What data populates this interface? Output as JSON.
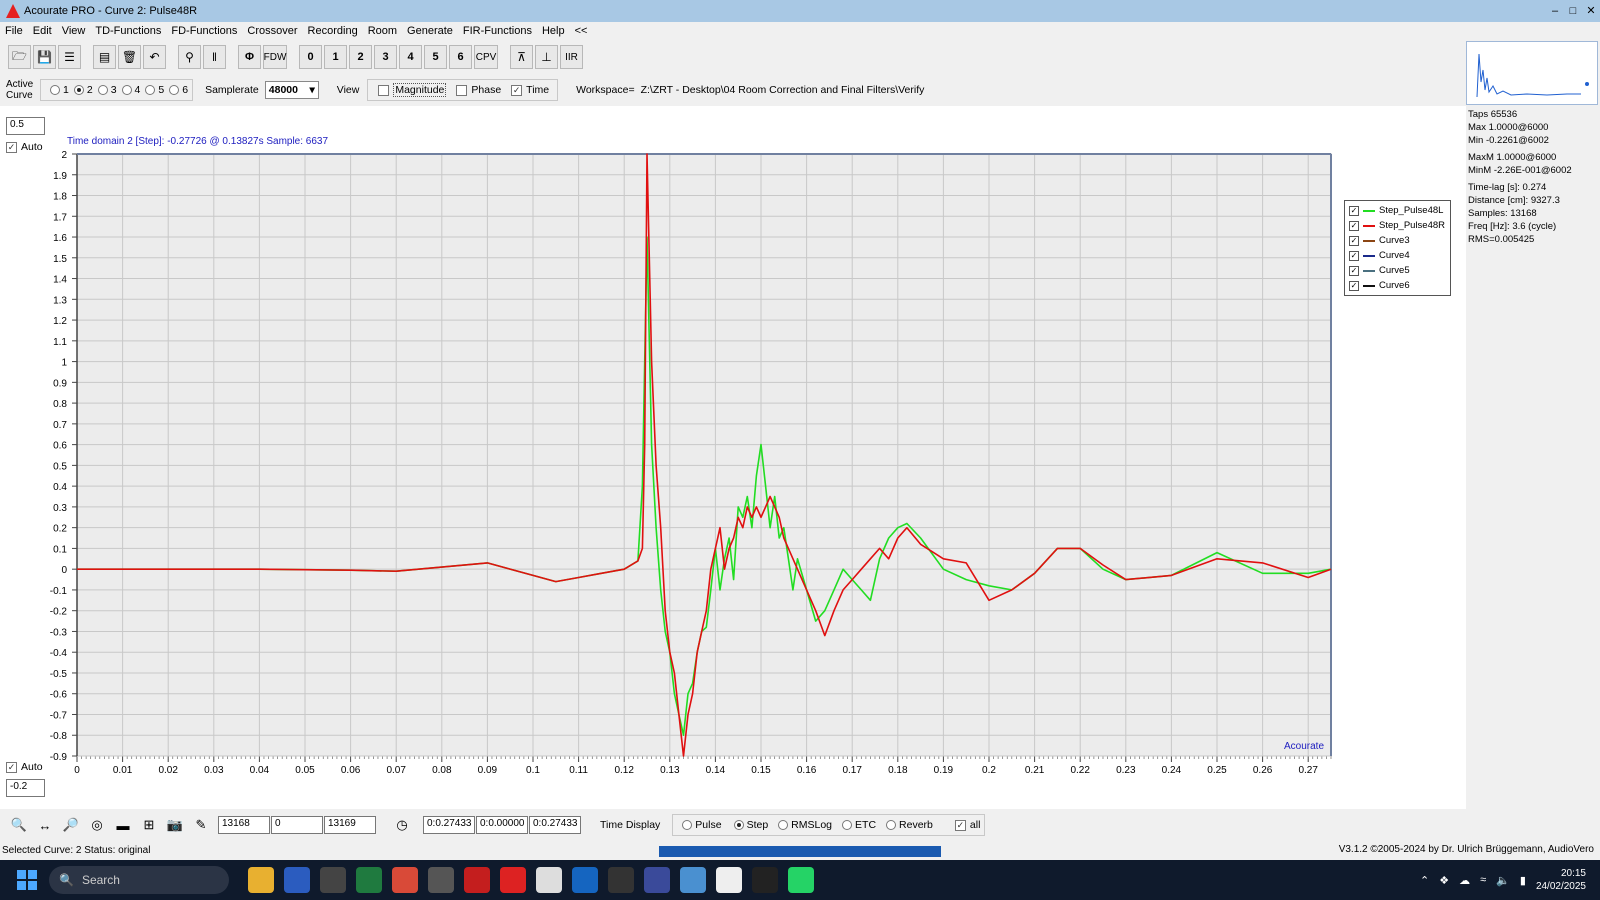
{
  "window": {
    "title": "Acourate PRO - Curve 2: Pulse48R",
    "minimize": "–",
    "maximize": "□",
    "close": "✕"
  },
  "menu": [
    "File",
    "Edit",
    "View",
    "TD-Functions",
    "FD-Functions",
    "Crossover",
    "Recording",
    "Room",
    "Generate",
    "FIR-Functions",
    "Help",
    "<<"
  ],
  "toolbar": {
    "icons": [
      "open-folder-icon",
      "save-icon",
      "tree-icon",
      "clipboard-icon",
      "trash-icon",
      "undo-icon",
      "branch-icon",
      "split-icon"
    ],
    "phi": "Φ",
    "fdw": "FDW",
    "curves": [
      "0",
      "1",
      "2",
      "3",
      "4",
      "5",
      "6"
    ],
    "cpv": "CPV",
    "iir": "IIR"
  },
  "controls": {
    "active_curve_label": "Active Curve",
    "curve_options": [
      "1",
      "2",
      "3",
      "4",
      "5",
      "6"
    ],
    "active_curve": "2",
    "samplerate_label": "Samplerate",
    "samplerate": "48000",
    "view_label": "View",
    "magnitude_label": "Magnitude",
    "phase_label": "Phase",
    "time_label": "Time",
    "workspace_label": "Workspace=",
    "workspace_path": "Z:\\ZRT - Desktop\\04 Room Correction and Final Filters\\Verify"
  },
  "info": {
    "taps": "Taps 65536",
    "max": "Max 1.0000@6000",
    "min": "Min -0.2261@6002",
    "maxm": "MaxM 1.0000@6000",
    "minm": "MinM -2.26E-001@6002",
    "timelag": "Time-lag [s]: 0.274",
    "distance": "Distance [cm]: 9327.3",
    "samples": "Samples: 13168",
    "freq": "Freq [Hz]: 3.6 (cycle)",
    "rms": "RMS=0.005425"
  },
  "plot": {
    "ymax_value": "0.5",
    "ymin_value": "-0.2",
    "auto_label": "Auto",
    "cursor_text": "Time domain 2 [Step]:  -0.27726 @ 0.13827s   Sample: 6637",
    "brand": "Acourate"
  },
  "chart_data": {
    "type": "line",
    "xlim": [
      0,
      0.275
    ],
    "ylim": [
      -0.9,
      2.0
    ],
    "x_ticks": [
      "0",
      "0.01",
      "0.02",
      "0.03",
      "0.04",
      "0.05",
      "0.06",
      "0.07",
      "0.08",
      "0.09",
      "0.1",
      "0.11",
      "0.12",
      "0.13",
      "0.14",
      "0.15",
      "0.16",
      "0.17",
      "0.18",
      "0.19",
      "0.2",
      "0.21",
      "0.22",
      "0.23",
      "0.24",
      "0.25",
      "0.26",
      "0.27"
    ],
    "y_ticks": [
      "2",
      "1.9",
      "1.8",
      "1.7",
      "1.6",
      "1.5",
      "1.4",
      "1.3",
      "1.2",
      "1.1",
      "1",
      "0.9",
      "0.8",
      "0.7",
      "0.6",
      "0.5",
      "0.4",
      "0.3",
      "0.2",
      "0.1",
      "0",
      "-0.1",
      "-0.2",
      "-0.3",
      "-0.4",
      "-0.5",
      "-0.6",
      "-0.7",
      "-0.8",
      "-0.9"
    ],
    "grid": true,
    "legend": [
      {
        "name": "Step_Pulse48L",
        "color": "#22dd22"
      },
      {
        "name": "Step_Pulse48R",
        "color": "#e01010"
      },
      {
        "name": "Curve3",
        "color": "#8b4513"
      },
      {
        "name": "Curve4",
        "color": "#1a2a8a"
      },
      {
        "name": "Curve5",
        "color": "#4a7080"
      },
      {
        "name": "Curve6",
        "color": "#111111"
      }
    ],
    "series": [
      {
        "name": "Step_Pulse48L",
        "color": "#22dd22",
        "x": [
          0,
          0.02,
          0.04,
          0.06,
          0.07,
          0.08,
          0.09,
          0.1,
          0.105,
          0.11,
          0.115,
          0.12,
          0.123,
          0.124,
          0.125,
          0.126,
          0.127,
          0.128,
          0.129,
          0.13,
          0.131,
          0.132,
          0.133,
          0.134,
          0.135,
          0.136,
          0.137,
          0.138,
          0.139,
          0.14,
          0.141,
          0.142,
          0.143,
          0.144,
          0.145,
          0.146,
          0.147,
          0.148,
          0.149,
          0.15,
          0.151,
          0.152,
          0.153,
          0.154,
          0.155,
          0.156,
          0.157,
          0.158,
          0.16,
          0.162,
          0.164,
          0.166,
          0.168,
          0.17,
          0.172,
          0.174,
          0.176,
          0.178,
          0.18,
          0.182,
          0.185,
          0.19,
          0.195,
          0.2,
          0.205,
          0.21,
          0.215,
          0.22,
          0.225,
          0.23,
          0.24,
          0.25,
          0.26,
          0.27,
          0.275
        ],
        "y": [
          0,
          0,
          0,
          -0.005,
          -0.01,
          0.01,
          0.03,
          -0.03,
          -0.06,
          -0.04,
          -0.02,
          0,
          0.04,
          0.4,
          1.6,
          0.6,
          0.2,
          -0.1,
          -0.3,
          -0.4,
          -0.6,
          -0.7,
          -0.8,
          -0.6,
          -0.55,
          -0.4,
          -0.3,
          -0.28,
          -0.1,
          0.1,
          -0.1,
          0.05,
          0.15,
          -0.05,
          0.3,
          0.25,
          0.35,
          0.2,
          0.45,
          0.6,
          0.4,
          0.2,
          0.35,
          0.15,
          0.2,
          0.05,
          -0.1,
          0.05,
          -0.1,
          -0.25,
          -0.2,
          -0.1,
          0,
          -0.05,
          -0.1,
          -0.15,
          0.05,
          0.15,
          0.2,
          0.22,
          0.15,
          0,
          -0.05,
          -0.08,
          -0.1,
          -0.02,
          0.1,
          0.1,
          0,
          -0.05,
          -0.03,
          0.08,
          -0.02,
          -0.02,
          0
        ]
      },
      {
        "name": "Step_Pulse48R",
        "color": "#e01010",
        "x": [
          0,
          0.02,
          0.04,
          0.06,
          0.07,
          0.08,
          0.09,
          0.1,
          0.105,
          0.11,
          0.115,
          0.12,
          0.123,
          0.124,
          0.1245,
          0.125,
          0.1255,
          0.126,
          0.127,
          0.128,
          0.129,
          0.13,
          0.131,
          0.132,
          0.133,
          0.134,
          0.135,
          0.136,
          0.137,
          0.138,
          0.139,
          0.14,
          0.141,
          0.142,
          0.143,
          0.144,
          0.145,
          0.146,
          0.147,
          0.148,
          0.149,
          0.15,
          0.151,
          0.152,
          0.153,
          0.154,
          0.155,
          0.156,
          0.158,
          0.16,
          0.162,
          0.164,
          0.166,
          0.168,
          0.17,
          0.172,
          0.174,
          0.176,
          0.178,
          0.18,
          0.182,
          0.185,
          0.19,
          0.195,
          0.2,
          0.205,
          0.21,
          0.215,
          0.22,
          0.225,
          0.23,
          0.24,
          0.25,
          0.26,
          0.27,
          0.275
        ],
        "y": [
          0,
          0,
          0,
          -0.005,
          -0.01,
          0.01,
          0.03,
          -0.03,
          -0.06,
          -0.04,
          -0.02,
          0,
          0.04,
          0.1,
          0.6,
          2.0,
          1.5,
          1.0,
          0.5,
          0.2,
          -0.2,
          -0.4,
          -0.5,
          -0.7,
          -0.9,
          -0.7,
          -0.6,
          -0.4,
          -0.3,
          -0.2,
          0,
          0.1,
          0.2,
          0,
          0.1,
          0.15,
          0.25,
          0.2,
          0.3,
          0.25,
          0.3,
          0.25,
          0.3,
          0.35,
          0.3,
          0.25,
          0.15,
          0.1,
          0,
          -0.1,
          -0.2,
          -0.32,
          -0.2,
          -0.1,
          -0.05,
          0,
          0.05,
          0.1,
          0.05,
          0.15,
          0.2,
          0.12,
          0.05,
          0.03,
          -0.15,
          -0.1,
          -0.02,
          0.1,
          0.1,
          0.02,
          -0.05,
          -0.03,
          0.05,
          0.03,
          -0.04,
          0
        ]
      }
    ]
  },
  "bottom": {
    "fields": [
      "13168",
      "0",
      "13169"
    ],
    "times": [
      "0:0.27433",
      "0:0.00000",
      "0:0.27433"
    ],
    "time_display_label": "Time Display",
    "modes": [
      "Pulse",
      "Step",
      "RMSLog",
      "ETC",
      "Reverb"
    ],
    "active_mode": "Step",
    "all_label": "all"
  },
  "status": {
    "text": "Selected Curve: 2   Status: original",
    "version": "V3.1.2 ©2005-2024 by Dr. Ulrich Brüggemann, AudioVero"
  },
  "taskbar": {
    "search_placeholder": "Search",
    "apps": [
      {
        "name": "file-explorer-icon",
        "color": "#e8b030"
      },
      {
        "name": "word-icon",
        "color": "#2b5cbf"
      },
      {
        "name": "magnifier-icon",
        "color": "#444"
      },
      {
        "name": "excel-icon",
        "color": "#1f7a3f"
      },
      {
        "name": "chrome-icon",
        "color": "#d94a38"
      },
      {
        "name": "cms-icon",
        "color": "#555"
      },
      {
        "name": "acrobat-icon",
        "color": "#c41e1e"
      },
      {
        "name": "acourate-icon",
        "color": "#d22"
      },
      {
        "name": "roon-icon",
        "color": "#ddd"
      },
      {
        "name": "outlook-icon",
        "color": "#1565c0"
      },
      {
        "name": "grid-app-icon",
        "color": "#333"
      },
      {
        "name": "rew-icon",
        "color": "#3a4a9a"
      },
      {
        "name": "writer-icon",
        "color": "#4a90d0"
      },
      {
        "name": "chat-icon",
        "color": "#eee"
      },
      {
        "name": "pixel-app-icon",
        "color": "#222"
      },
      {
        "name": "whatsapp-icon",
        "color": "#25d366"
      }
    ],
    "time": "20:15",
    "date": "24/02/2025"
  }
}
